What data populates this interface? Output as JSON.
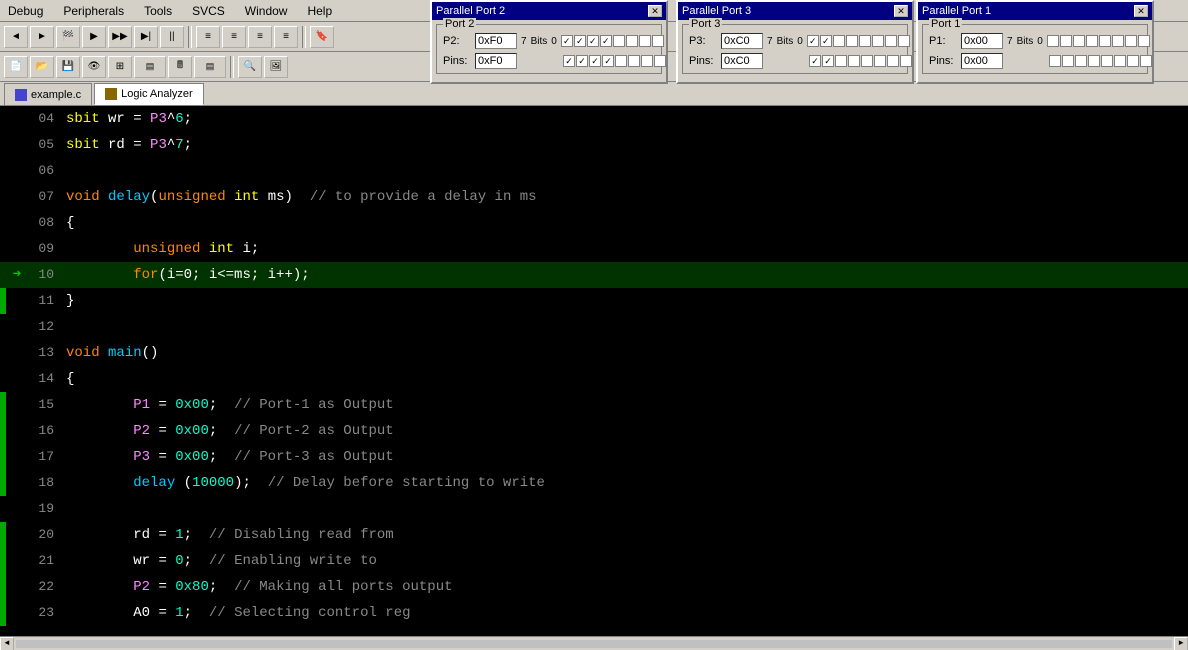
{
  "menubar": {
    "items": [
      "Debug",
      "Peripherals",
      "Tools",
      "SVCS",
      "Window",
      "Help"
    ]
  },
  "tabs": [
    {
      "id": "example-c",
      "label": "example.c",
      "active": false
    },
    {
      "id": "logic-analyzer",
      "label": "Logic Analyzer",
      "active": true
    }
  ],
  "parallel_ports": [
    {
      "id": "pp2",
      "title": "Parallel Port 2",
      "group_label": "Port 2",
      "port_label": "P2:",
      "port_value": "0xF0",
      "pins_label": "Pins:",
      "pins_value": "0xF0",
      "bits_7": "7",
      "bits_0": "0",
      "bits_label": "Bits",
      "p2_checks": [
        true,
        true,
        true,
        true,
        false,
        false,
        false,
        false
      ],
      "pins_checks": [
        true,
        true,
        true,
        true,
        false,
        false,
        false,
        false
      ],
      "left": "430",
      "top": "0"
    },
    {
      "id": "pp3",
      "title": "Parallel Port 3",
      "group_label": "Port 3",
      "port_label": "P3:",
      "port_value": "0xC0",
      "pins_label": "Pins:",
      "pins_value": "0xC0",
      "bits_7": "7",
      "bits_0": "0",
      "bits_label": "Bits",
      "p2_checks": [
        true,
        true,
        false,
        false,
        false,
        false,
        false,
        false
      ],
      "pins_checks": [
        true,
        true,
        false,
        false,
        false,
        false,
        false,
        false
      ],
      "left": "675",
      "top": "0"
    },
    {
      "id": "pp1",
      "title": "Parallel Port 1",
      "group_label": "Port 1",
      "port_label": "P1:",
      "port_value": "0x00",
      "pins_label": "Pins:",
      "pins_value": "0x00",
      "bits_7": "7",
      "bits_0": "0",
      "bits_label": "Bits",
      "p2_checks": [
        false,
        false,
        false,
        false,
        false,
        false,
        false,
        false
      ],
      "pins_checks": [
        false,
        false,
        false,
        false,
        false,
        false,
        false,
        false
      ],
      "left": "915",
      "top": "0"
    }
  ],
  "code": {
    "lines": [
      {
        "num": "04",
        "text": "sbit wr = P3^6;",
        "type": "sbit-assign",
        "has_green": false,
        "is_current": false
      },
      {
        "num": "05",
        "text": "sbit rd = P3^7;",
        "type": "sbit-assign",
        "has_green": false,
        "is_current": false
      },
      {
        "num": "06",
        "text": "",
        "type": "empty",
        "has_green": false,
        "is_current": false
      },
      {
        "num": "07",
        "text": "void delay(unsigned int ms)  // to provide a delay in ms",
        "type": "func-def",
        "has_green": false,
        "is_current": false
      },
      {
        "num": "08",
        "text": "{",
        "type": "brace",
        "has_green": false,
        "is_current": false
      },
      {
        "num": "09",
        "text": "        unsigned int i;",
        "type": "var-decl",
        "has_green": false,
        "is_current": false
      },
      {
        "num": "10",
        "text": "        for(i=0; i<=ms; i++);",
        "type": "for-loop",
        "has_green": true,
        "is_current": true
      },
      {
        "num": "11",
        "text": "}",
        "type": "brace",
        "has_green": true,
        "is_current": false
      },
      {
        "num": "12",
        "text": "",
        "type": "empty",
        "has_green": false,
        "is_current": false
      },
      {
        "num": "13",
        "text": "void main()",
        "type": "func-def",
        "has_green": false,
        "is_current": false
      },
      {
        "num": "14",
        "text": "{",
        "type": "brace",
        "has_green": false,
        "is_current": false
      },
      {
        "num": "15",
        "text": "        P1 = 0x00;  // Port-1 as Output",
        "type": "assign",
        "has_green": true,
        "is_current": false
      },
      {
        "num": "16",
        "text": "        P2 = 0x00;  // Port-2 as Output",
        "type": "assign",
        "has_green": true,
        "is_current": false
      },
      {
        "num": "17",
        "text": "        P3 = 0x00;  // Port-3 as Output",
        "type": "assign",
        "has_green": true,
        "is_current": false
      },
      {
        "num": "18",
        "text": "        delay (10000);  // Delay before starting to write",
        "type": "call",
        "has_green": true,
        "is_current": false
      },
      {
        "num": "19",
        "text": "",
        "type": "empty",
        "has_green": false,
        "is_current": false
      },
      {
        "num": "20",
        "text": "        rd = 1;  // Disabling read from",
        "type": "assign",
        "has_green": true,
        "is_current": false
      },
      {
        "num": "21",
        "text": "        wr = 0;  // Enabling write to",
        "type": "assign",
        "has_green": true,
        "is_current": false
      },
      {
        "num": "22",
        "text": "        P2 = 0x80;  // Making all ports output",
        "type": "assign",
        "has_green": true,
        "is_current": false
      },
      {
        "num": "23",
        "text": "        A0 = 1;  // Selecting control reg",
        "type": "assign",
        "has_green": true,
        "is_current": false
      }
    ]
  },
  "scrollbar": {
    "left_arrow": "◄",
    "right_arrow": "►"
  }
}
